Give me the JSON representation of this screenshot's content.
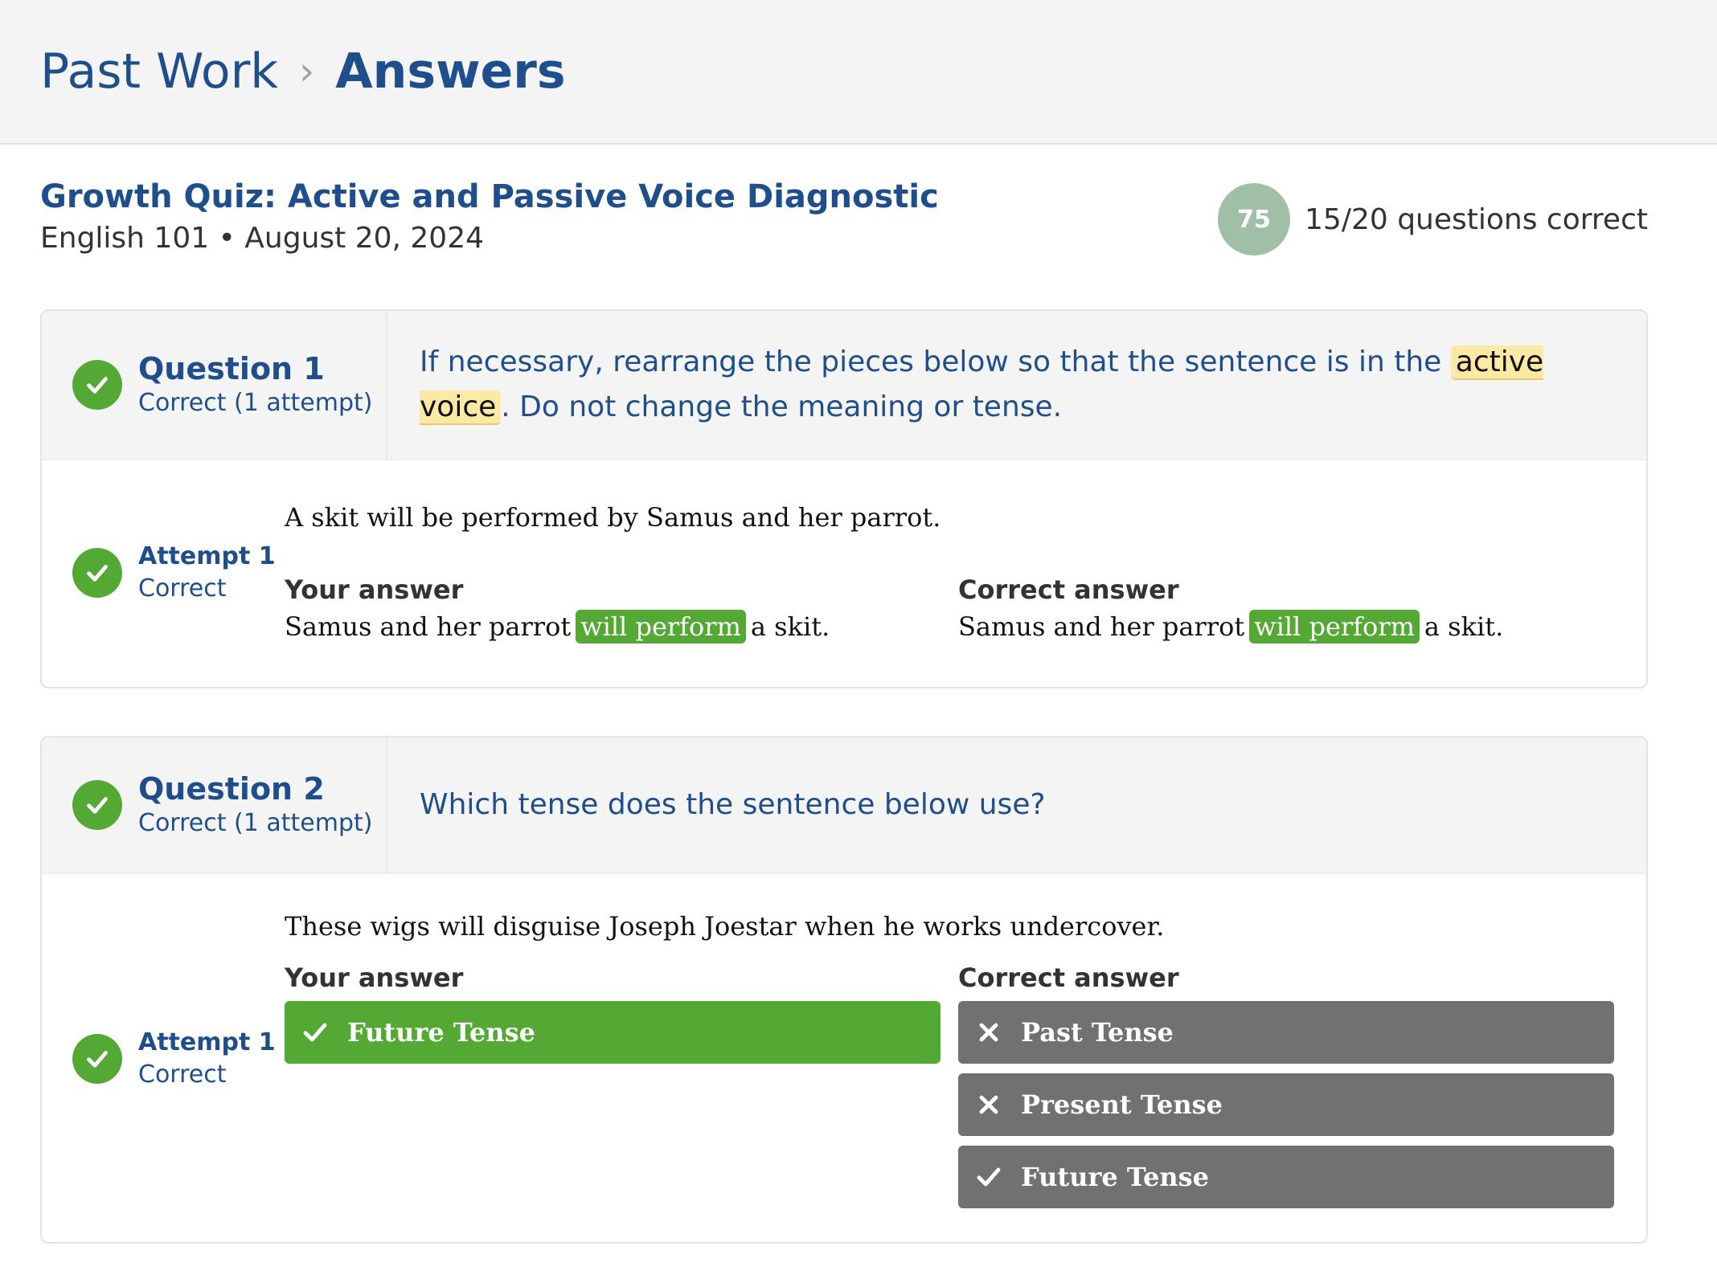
{
  "breadcrumb": {
    "parent": "Past Work",
    "separator": "›",
    "current": "Answers"
  },
  "quiz": {
    "title": "Growth Quiz: Active and Passive Voice Diagnostic",
    "meta": "English 101 • August 20, 2024",
    "score": "75",
    "score_text": "15/20 questions correct"
  },
  "questions": [
    {
      "title": "Question 1",
      "status": "Correct (1 attempt)",
      "prompt_before": "If necessary, rearrange the pieces below so that the sentence is in the ",
      "prompt_highlight": "active voice",
      "prompt_after": ". Do not change the meaning or tense.",
      "attempt_title": "Attempt 1",
      "attempt_status": "Correct",
      "sentence": "A skit will be performed by Samus and her parrot.",
      "your_label": "Your answer",
      "correct_label": "Correct answer",
      "your_answer": {
        "before": "Samus and her parrot",
        "chip": "will perform",
        "after": "a skit."
      },
      "correct_answer": {
        "before": "Samus and her parrot",
        "chip": "will perform",
        "after": "a skit."
      }
    },
    {
      "title": "Question 2",
      "status": "Correct (1 attempt)",
      "prompt": "Which tense does the sentence below use?",
      "attempt_title": "Attempt 1",
      "attempt_status": "Correct",
      "sentence": "These wigs will disguise Joseph Joestar when he works undercover.",
      "your_label": "Your answer",
      "correct_label": "Correct answer",
      "your_answer": "Future Tense",
      "correct_options": [
        {
          "label": "Past Tense",
          "icon": "x-icon"
        },
        {
          "label": "Present Tense",
          "icon": "x-icon"
        },
        {
          "label": "Future Tense",
          "icon": "check-icon"
        }
      ]
    }
  ],
  "colors": {
    "accent": "#1f4e8c",
    "correct": "#54a934",
    "neutral": "#717171",
    "highlight": "#fde9a6",
    "score": "#9fc0a6"
  }
}
